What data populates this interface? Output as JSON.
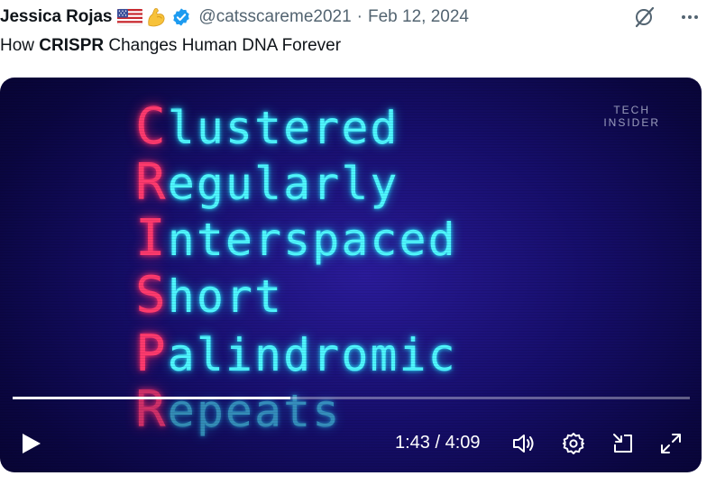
{
  "tweet": {
    "author_name": "Jessica Rojas",
    "handle": "@catsscareme2021",
    "separator": "·",
    "date": "Feb 12, 2024",
    "text_prefix": "How ",
    "text_bold": "CRISPR",
    "text_suffix": " Changes Human DNA Forever",
    "emojis": [
      "flag-us-icon",
      "flexed-biceps-icon"
    ],
    "verified": true,
    "header_actions": [
      "grok-icon",
      "more-icon"
    ]
  },
  "video": {
    "brand_line1": "TECH",
    "brand_line2": "INSIDER",
    "acronym": [
      {
        "first": "C",
        "rest": "lustered"
      },
      {
        "first": "R",
        "rest": "egularly"
      },
      {
        "first": "I",
        "rest": "nterspaced"
      },
      {
        "first": "S",
        "rest": "hort"
      },
      {
        "first": "P",
        "rest": "alindromic"
      },
      {
        "first": "R",
        "rest": "epeats"
      }
    ],
    "current_time": "1:43",
    "duration": "4:09",
    "time_display": "1:43 / 4:09",
    "progress_fraction": 0.41,
    "controls": [
      "play-icon",
      "volume-icon",
      "settings-icon",
      "pip-icon",
      "fullscreen-icon"
    ]
  },
  "colors": {
    "accent_blue": "#1d9bf0",
    "text_secondary": "#536471",
    "acronym_first": "#ff3a6e",
    "acronym_rest": "#4ff6ff"
  }
}
